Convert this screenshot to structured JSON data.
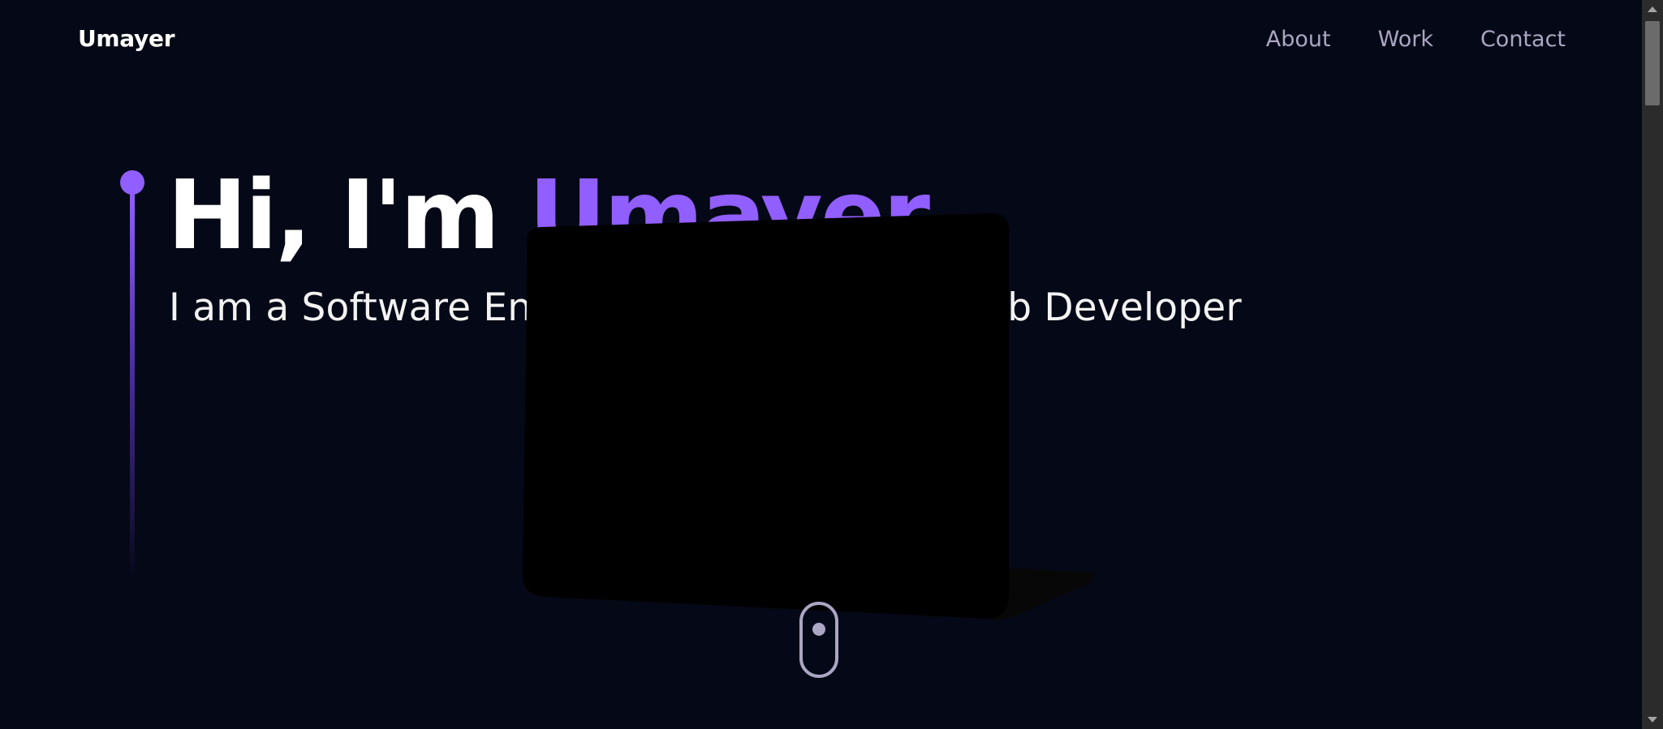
{
  "navbar": {
    "logo": "Umayer",
    "links": [
      {
        "label": "About"
      },
      {
        "label": "Work"
      },
      {
        "label": "Contact"
      }
    ]
  },
  "hero": {
    "title_prefix": "Hi, I'm ",
    "title_name": "Umayer",
    "subtitle": "I am a Software Engineer and Full Stack Web Developer"
  },
  "colors": {
    "background": "#050816",
    "accent": "#915eff",
    "nav_text": "#aaa6c3"
  },
  "icons": {
    "scroll": "mouse-scroll-icon"
  }
}
